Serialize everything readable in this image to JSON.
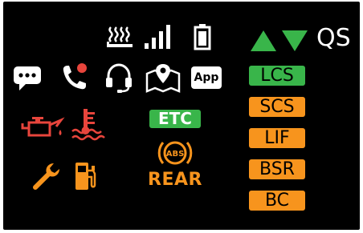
{
  "qs_label": "QS",
  "app_label": "App",
  "etc_label": "ETC",
  "abs_label": "ABS",
  "rear_label": "REAR",
  "right_badges": {
    "lcs": "LCS",
    "scs": "SCS",
    "lif": "LIF",
    "bsr": "BSR",
    "bc": "BC"
  },
  "icons": {
    "heater": "seat-heater-icon",
    "signal": "signal-strength-icon",
    "battery": "battery-icon",
    "message": "message-bubble-icon",
    "missed_call": "missed-call-icon",
    "headset": "headset-icon",
    "navigation": "map-navigation-icon",
    "oil": "oil-pressure-icon",
    "coolant": "coolant-temperature-icon",
    "service": "wrench-service-icon",
    "fuel": "low-fuel-icon",
    "up": "up-arrow-icon",
    "down": "down-arrow-icon"
  },
  "colors": {
    "background": "#000000",
    "white": "#ffffff",
    "green": "#39b54a",
    "orange": "#f7941d",
    "red": "#e8453c"
  }
}
